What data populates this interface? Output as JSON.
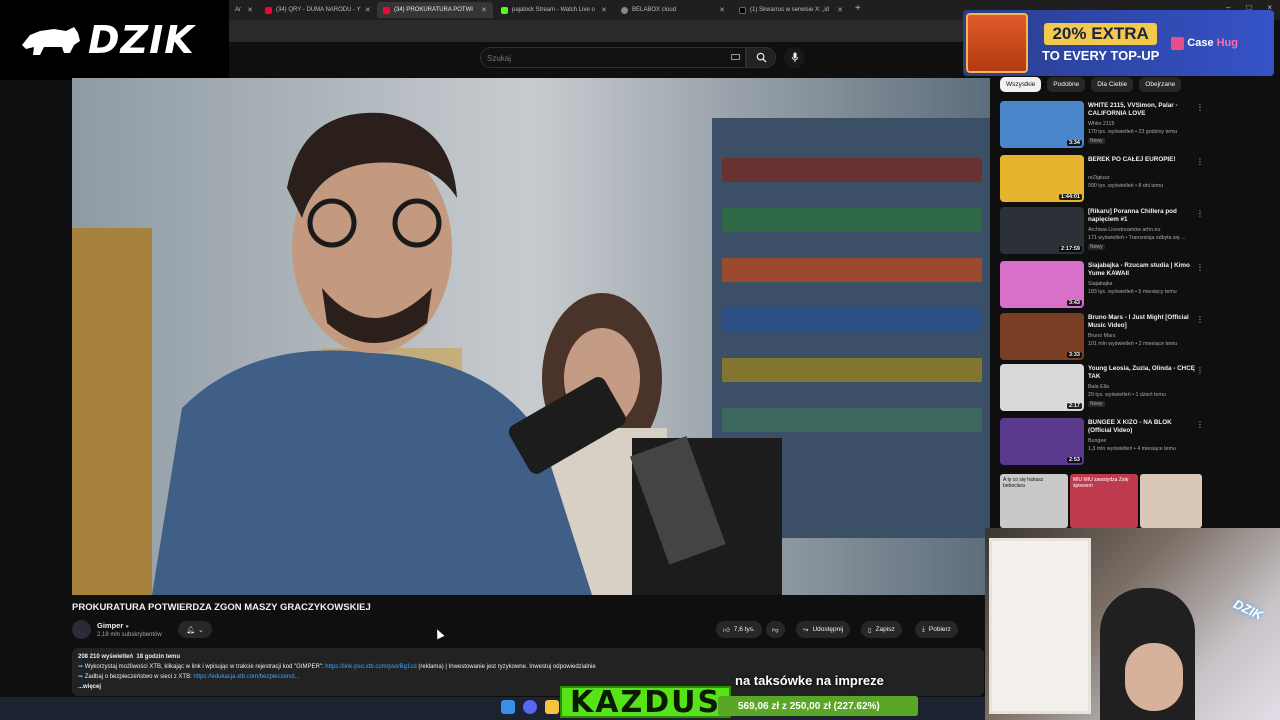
{
  "browser": {
    "tabs": [
      {
        "title": "Ar",
        "active": false
      },
      {
        "title": "(34) QRY - DUMA NARODU - Y",
        "active": false
      },
      {
        "title": "(34) PROKURATURA POTWI",
        "active": true
      },
      {
        "title": "pajalock Stream - Watch Live o",
        "active": false
      },
      {
        "title": "BELABOX cloud",
        "active": false
      },
      {
        "title": "(1) Skwarrus w serwisie X: „id",
        "active": false
      }
    ],
    "new_tab": "+",
    "window_controls": [
      "–",
      "□",
      "×"
    ]
  },
  "youtube": {
    "search_placeholder": "Szukaj",
    "video": {
      "title": "PROKURATURA POTWIERDZA ZGON MASZY GRACZYKOWSKIEJ",
      "channel": "Gimper",
      "subscribers": "2,18 mln subskrybentów",
      "likes": "7,6 tys.",
      "share_label": "Udostępnij",
      "save_label": "Zapisz",
      "download_label": "Pobierz",
      "views": "208 210 wyświetleń",
      "published": "18 godzin temu",
      "desc_line1_prefix": "Wykorzystaj możliwości XTB, klikając w link i wpisując w trakcie rejestracji kod \"GIMPER\": ",
      "desc_line1_link": "https://link-pso.xtb.com/pso/Bg1cd",
      "desc_line1_suffix": " (reklama) | Inwestowanie jest ryzykowne. Inwestuj odpowiedzialnie",
      "desc_line2_prefix": "Zadbaj o bezpieczeństwo w sieci z XTB: ",
      "desc_line2_link": "https://edukacja.xtb.com/bezpieczenst...",
      "more": "...więcej"
    },
    "chips": [
      "Wszystkie",
      "Podobne",
      "Dla Ciebie",
      "Obejrzane"
    ],
    "recommendations": [
      {
        "title": "WHITE 2115, VVSimon, Palar - CALIFORNIA LOVE",
        "channel": "White 2115",
        "views": "170 tys. wyświetleń • 23 godziny temu",
        "badge": "Nowy",
        "duration": "3:34",
        "thumb_color": "#4a86c9"
      },
      {
        "title": "BEREK PO CAŁEJ EUROPIE!",
        "channel": "reZigiusz",
        "views": "990 tys. wyświetleń • 8 dni temu",
        "badge": "",
        "duration": "1:44:01",
        "thumb_color": "#e7b52d"
      },
      {
        "title": "[Rikaru] Poranna Chillera pod napięciem #1",
        "channel": "Archiwa Livestreamów arhn.eu",
        "views": "171 wyświetleń • Transmisja odbyła się ...",
        "badge": "Nowy",
        "duration": "2:17:59",
        "thumb_color": "#2b3136"
      },
      {
        "title": "Siajabajka - Rzucam studia | Kimo Yume KAWAII",
        "channel": "Siajabajka",
        "views": "183 tys. wyświetleń • 5 miesięcy temu",
        "badge": "",
        "duration": "3:43",
        "thumb_color": "#d86fc9"
      },
      {
        "title": "Bruno Mars - I Just Might [Official Music Video]",
        "channel": "Bruno Mars",
        "views": "101 mln wyświetleń • 2 miesiące temu",
        "badge": "",
        "duration": "3:33",
        "thumb_color": "#7a3e24"
      },
      {
        "title": "Young Leosia, Zuzia, Olinda - CHCĘ TAK",
        "channel": "Bala Ella",
        "views": "29 tys. wyświetleń • 1 dzień temu",
        "badge": "Nowy",
        "duration": "2:17",
        "thumb_color": "#d9d9d9"
      },
      {
        "title": "BUNGEE X KIZO - NA BLOK (Official Video)",
        "channel": "Bungee",
        "views": "1,3 mln wyświetleń • 4 miesiące temu",
        "badge": "",
        "duration": "2:53",
        "thumb_color": "#5a3a8c"
      }
    ],
    "extra_thumbs": [
      {
        "text": "A ty co się hahasz bebeclara",
        "color": "#c9c9c9"
      },
      {
        "text": "MIU MIU zawstydza Zalę śpiewem",
        "color": "#c03a4e"
      },
      {
        "text": "",
        "color": "#d9c8b8"
      }
    ]
  },
  "overlay": {
    "brand": "DZIK",
    "ad_big": "20% EXTRA",
    "ad_small": "TO EVERY TOP-UP",
    "ad_brand_a": "Case",
    "ad_brand_b": "Hug",
    "cam_sign": "DZIK",
    "ticker": "na taksówke na impreze",
    "donor": "KAZDUS",
    "goal": "569,06 zł z 250,00 zł (227.62%)",
    "goal_progress": 1.0
  },
  "colors": {
    "accent": "#ff0000",
    "link": "#3ea6ff",
    "casehug_bg": "#3552c8",
    "donation": "#8cc63f"
  }
}
